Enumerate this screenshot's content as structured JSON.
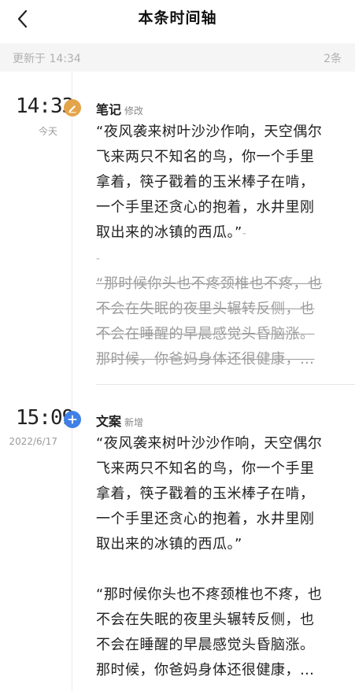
{
  "header": {
    "back_icon": "chevron-left-icon",
    "title": "本条时间轴"
  },
  "meta": {
    "updated": "更新于 14:34",
    "count": "2条"
  },
  "colors": {
    "edit_dot": "#e4a44a",
    "add_dot": "#3f80e6",
    "divider": "#e6e6e6",
    "strike_text": "#9c9c9c"
  },
  "entries": [
    {
      "time": "14:33",
      "date": "今天",
      "icon": "edit-pencil-icon",
      "type": "笔记",
      "action": "修改",
      "para1_lines": [
        "“夜风袭来树叶沙沙作响，天空偶尔",
        "飞来两只不知名的鸟，你一个手里",
        "拿着，筷子戳着的玉米棒子在啃，",
        "一个手里还贪心的抱着，水井里刚",
        "取出来的冰镇的西瓜。”"
      ],
      "marker_after": "-",
      "marker_line": "-",
      "para2_lines": [
        "“那时候你头也不疼颈椎也不疼，也",
        "不会在失眠的夜里头辗转反侧，也",
        "不会在睡醒的早晨感觉头昏脑涨。",
        "那时候，你爸妈身体还很健康，…"
      ]
    },
    {
      "time": "15:09",
      "date": "2022/6/17",
      "icon": "plus-icon",
      "type": "文案",
      "action": "新增",
      "para1_lines": [
        "“夜风袭来树叶沙沙作响，天空偶尔",
        "飞来两只不知名的鸟，你一个手里",
        "拿着，筷子戳着的玉米棒子在啃，",
        "一个手里还贪心的抱着，水井里刚",
        "取出来的冰镇的西瓜。”"
      ],
      "para2_lines": [
        "“那时候你头也不疼颈椎也不疼，也",
        "不会在失眠的夜里头辗转反侧，也",
        "不会在睡醒的早晨感觉头昏脑涨。",
        "那时候，你爸妈身体还很健康，…"
      ]
    }
  ]
}
